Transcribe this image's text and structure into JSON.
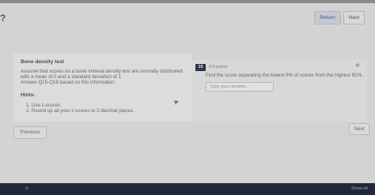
{
  "toolbar": {
    "left_icon": "?",
    "return_label": "Return",
    "next_label": "Next"
  },
  "content": {
    "title": "Bone density test",
    "lines": [
      "Assume that scores on a bone mineral density test are normally distributed",
      "with a mean of 0 and a standard deviation of 1.",
      "Answer Q15-Q18 based on this information."
    ],
    "hints_title": "Hints:",
    "hints": [
      "1. Use z-scores.",
      "2. Round up all your z-scores to 2 decimal places."
    ]
  },
  "question": {
    "number": "15",
    "points": "0.5 points",
    "pin_icon": "✲",
    "text": "Find the score separating the lowest 9% of scores from the highest 91%.",
    "input_placeholder": "Type your answer..."
  },
  "cursor_icon": "➤",
  "nav": {
    "previous_label": "Previous",
    "next_label": "Next"
  },
  "taskbar": {
    "chevron": "˄",
    "show_all_label": "Show all"
  }
}
